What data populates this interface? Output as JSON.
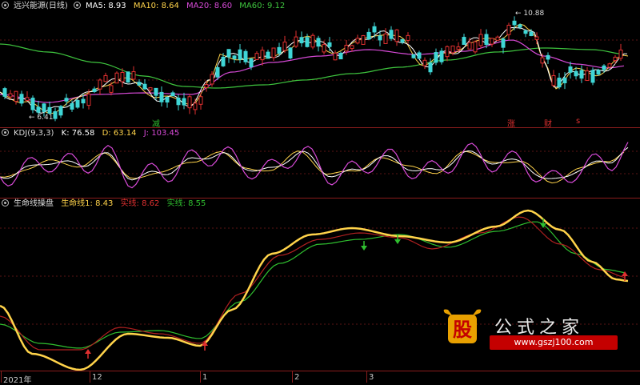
{
  "main": {
    "title": "远兴能源(日线)",
    "ma": [
      {
        "label": "MA5:",
        "value": "8.93",
        "color": "#ffffff"
      },
      {
        "label": "MA10:",
        "value": "8.64",
        "color": "#ffd34a"
      },
      {
        "label": "MA20:",
        "value": "8.60",
        "color": "#d84ad8"
      },
      {
        "label": "MA60:",
        "value": "9.12",
        "color": "#3ec43e"
      }
    ],
    "high_label": "10.88",
    "low_label": "6.41",
    "events": {
      "reduce": "减",
      "up": "涨",
      "fin": "财",
      "s": "s"
    }
  },
  "kdj": {
    "title": "KDJ(9,3,3)",
    "k_label": "K:",
    "k_value": "76.58",
    "k_color": "#ffffff",
    "d_label": "D:",
    "d_value": "63.14",
    "d_color": "#ffd34a",
    "j_label": "J:",
    "j_value": "103.45",
    "j_color": "#d84ad8"
  },
  "life": {
    "title": "生命线操盘",
    "line_label": "生命线1:",
    "line_value": "8.43",
    "line_color": "#ffd34a",
    "real_label": "实线:",
    "real_value": "8.62",
    "real_color": "#e03030",
    "real2_label": "实线:",
    "real2_value": "8.55",
    "real2_color": "#2fbf2f"
  },
  "axis": {
    "ticks": [
      "2021年",
      "12",
      "1",
      "2",
      "3"
    ]
  },
  "watermark": {
    "logo_char": "股",
    "text": "公式之家",
    "url": "www.gszj100.com"
  }
}
